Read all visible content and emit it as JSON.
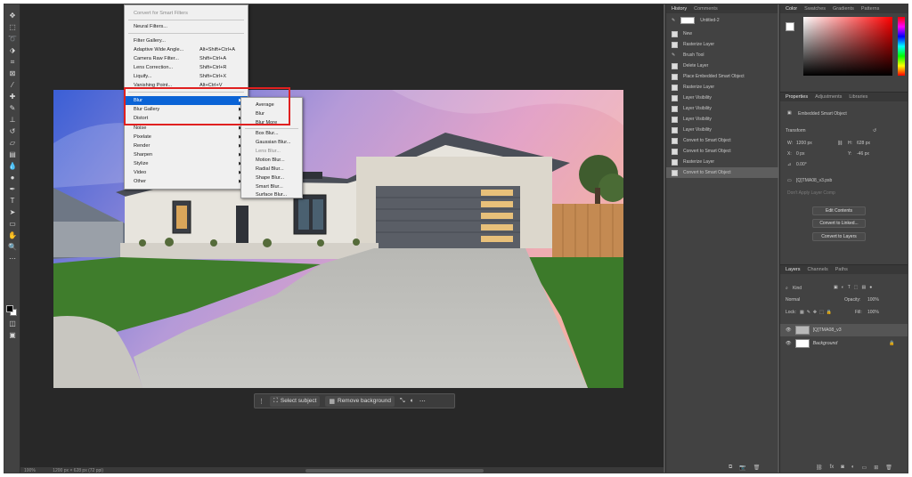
{
  "filter_menu": {
    "items": [
      {
        "label": "Convert for Smart Filters",
        "disabled": true
      },
      {
        "label": "Neural Filters..."
      },
      {
        "label": "Filter Gallery..."
      },
      {
        "label": "Adaptive Wide Angle...",
        "shortcut": "Alt+Shift+Ctrl+A"
      },
      {
        "label": "Camera Raw Filter...",
        "shortcut": "Shift+Ctrl+A"
      },
      {
        "label": "Lens Correction...",
        "shortcut": "Shift+Ctrl+R"
      },
      {
        "label": "Liquify...",
        "shortcut": "Shift+Ctrl+X"
      },
      {
        "label": "Vanishing Point...",
        "shortcut": "Alt+Ctrl+V"
      },
      {
        "label": "Blur",
        "submenu": true,
        "active": true
      },
      {
        "label": "Blur Gallery",
        "submenu": true
      },
      {
        "label": "Distort",
        "submenu": true
      },
      {
        "label": "Noise",
        "submenu": true
      },
      {
        "label": "Pixelate",
        "submenu": true
      },
      {
        "label": "Render",
        "submenu": true
      },
      {
        "label": "Sharpen",
        "submenu": true
      },
      {
        "label": "Stylize",
        "submenu": true
      },
      {
        "label": "Video",
        "submenu": true
      },
      {
        "label": "Other",
        "submenu": true
      }
    ]
  },
  "blur_submenu": {
    "items": [
      {
        "label": "Average"
      },
      {
        "label": "Blur"
      },
      {
        "label": "Blur More"
      },
      {
        "label": "Box Blur..."
      },
      {
        "label": "Gaussian Blur..."
      },
      {
        "label": "Lens Blur...",
        "disabled": true
      },
      {
        "label": "Motion Blur..."
      },
      {
        "label": "Radial Blur..."
      },
      {
        "label": "Shape Blur..."
      },
      {
        "label": "Smart Blur..."
      },
      {
        "label": "Surface Blur..."
      }
    ]
  },
  "taskbar": {
    "select_subject": "Select subject",
    "remove_background": "Remove background"
  },
  "status": {
    "zoom": "100%",
    "doc_size": "1200 px × 628 px (72 ppi)"
  },
  "history": {
    "tabs": [
      "History",
      "Comments"
    ],
    "snapshot_label": "Untitled-2",
    "items": [
      "New",
      "Rasterize Layer",
      "Brush Tool",
      "Delete Layer",
      "Place Embedded Smart Object",
      "Rasterize Layer",
      "Layer Visibility",
      "Layer Visibility",
      "Layer Visibility",
      "Layer Visibility",
      "Convert to Smart Object",
      "Convert to Smart Object",
      "Rasterize Layer",
      "Convert to Smart Object"
    ]
  },
  "color_panel": {
    "tabs": [
      "Color",
      "Swatches",
      "Gradients",
      "Patterns"
    ]
  },
  "properties": {
    "tabs": [
      "Properties",
      "Adjustments",
      "Libraries"
    ],
    "object_type": "Embedded Smart Object",
    "transform_label": "Transform",
    "w_label": "W:",
    "w": "1200 px",
    "h_label": "H:",
    "h": "628 px",
    "x_label": "X:",
    "x": "0 px",
    "y_label": "Y:",
    "y": "-46 px",
    "angle": "0.00°",
    "filename": "[Q]TMA08_v3.psb",
    "apply_label": "Don't Apply Layer Comp",
    "btn_edit": "Edit Contents",
    "btn_linked": "Convert to Linked...",
    "btn_layers": "Convert to Layers"
  },
  "layers": {
    "tabs": [
      "Layers",
      "Channels",
      "Paths"
    ],
    "kind": "Kind",
    "blend_mode": "Normal",
    "opacity_label": "Opacity:",
    "opacity": "100%",
    "lock_label": "Lock:",
    "fill_label": "Fill:",
    "fill": "100%",
    "rows": [
      {
        "name": "[Q]TMA08_v3"
      },
      {
        "name": "Background"
      }
    ]
  }
}
